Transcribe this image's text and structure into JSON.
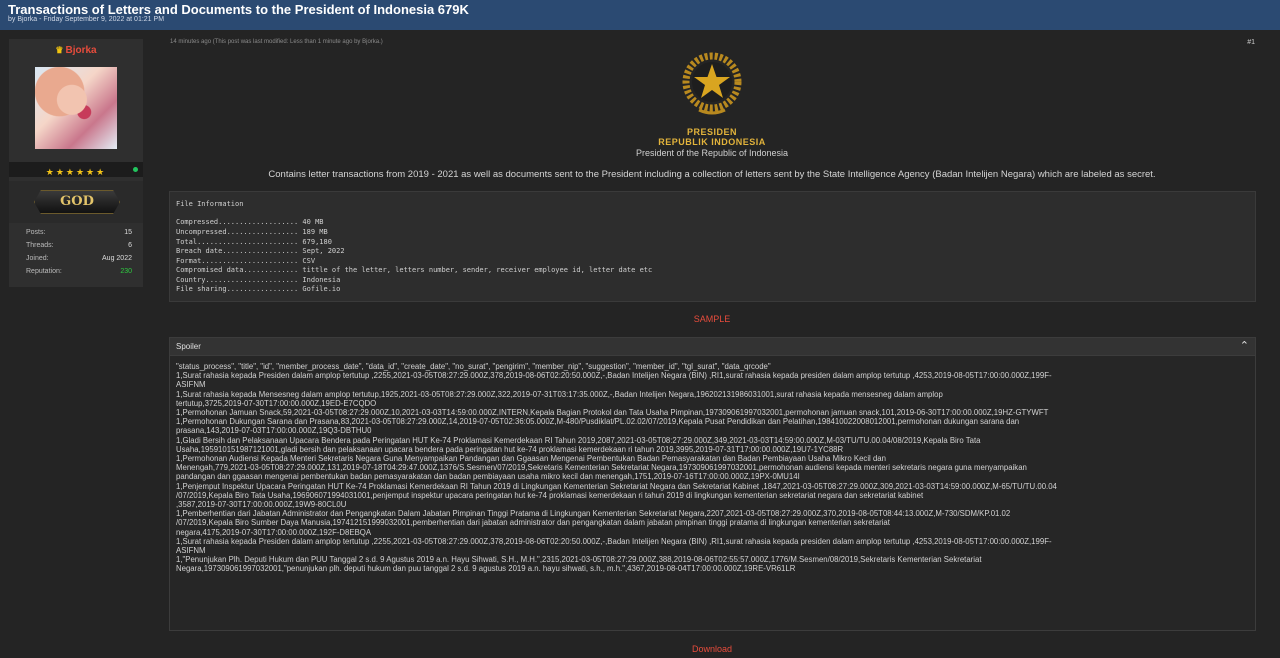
{
  "thread": {
    "title": "Transactions of Letters and Documents to the President of Indonesia 679K",
    "byline": "by Bjorka - Friday September 9, 2022 at 01:21 PM"
  },
  "user": {
    "name": "Bjorka",
    "stars": "★★★★★★",
    "rank_badge": "GOD",
    "stats": [
      {
        "label": "Posts:",
        "value": "15"
      },
      {
        "label": "Threads:",
        "value": "6"
      },
      {
        "label": "Joined:",
        "value": "Aug 2022"
      },
      {
        "label": "Reputation:",
        "value": "230"
      }
    ],
    "colors": {
      "name": "#e74c3c",
      "reputation": "#2ecc40",
      "online": "#22c55e"
    }
  },
  "post": {
    "meta": "14 minutes ago  (This post was last modified: Less than 1 minute ago by Bjorka.)",
    "number": "#1",
    "emblem_lines": [
      "PRESIDEN",
      "REPUBLIK INDONESIA"
    ],
    "emblem_subtitle": "President of the Republic of Indonesia",
    "description": "Contains letter transactions from 2019 - 2021 as well as documents sent to the President including a collection of letters sent by the State Intelligence Agency (Badan Intelijen Negara) which are labeled as secret.",
    "file_info": [
      "File Information",
      "",
      "Compressed................... 40 MB",
      "Uncompressed................. 189 MB",
      "Total........................ 679,180",
      "Breach date.................. Sept, 2022",
      "Format....................... CSV",
      "Compromised data............. tittle of the letter, letters number, sender, receiver employee id, letter date etc",
      "Country...................... Indonesia",
      "File sharing................. Gofile.io"
    ],
    "sample_label": "SAMPLE",
    "spoiler_label": "Spoiler",
    "spoiler_lines": [
      "\"status_process\", \"title\", \"id\", \"member_process_date\", \"data_id\", \"create_date\", \"no_surat\", \"pengirim\", \"member_nip\", \"suggestion\", \"member_id\", \"tgl_surat\", \"data_qrcode\"",
      "1,Surat rahasia kepada Presiden dalam amplop tertutup ,2255,2021-03-05T08:27:29.000Z,378,2019-08-06T02:20:50.000Z,-,Badan Intelijen Negara (BIN) ,RI1,surat rahasia kepada presiden dalam amplop tertutup ,4253,2019-08-05T17:00:00.000Z,199F-",
      "ASIFNM",
      "1,Surat rahasia kepada Mensesneg dalam amplop tertutup,1925,2021-03-05T08:27:29.000Z,322,2019-07-31T03:17:35.000Z,-,Badan Intelijen Negara,196202131986031001,surat rahasia kepada mensesneg dalam amplop",
      "tertutup,3725,2019-07-30T17:00:00.000Z,19ED-E7CQDO",
      "1,Permohonan Jamuan Snack,59,2021-03-05T08:27:29.000Z,10,2021-03-03T14:59:00.000Z,INTERN,Kepala Bagian Protokol dan Tata Usaha Pimpinan,197309061997032001,permohonan jamuan snack,101,2019-06-30T17:00:00.000Z,19HZ-GTYWFT",
      "1,Permohonan Dukungan Sarana dan Prasana,83,2021-03-05T08:27:29.000Z,14,2019-07-05T02:36:05.000Z,M-480/Pusdiklat/PL.02.02/07/2019,Kepala Pusat Pendidikan dan Pelatihan,198410022008012001,permohonan dukungan sarana dan",
      "prasana,143,2019-07-03T17:00:00.000Z,19Q3-DBTHU0",
      "1,Gladi Bersih dan Pelaksanaan Upacara Bendera pada Peringatan HUT Ke-74 Proklamasi Kemerdekaan RI Tahun 2019,2087,2021-03-05T08:27:29.000Z,349,2021-03-03T14:59:00.000Z,M-03/TU/TU.00.04/08/2019,Kepala Biro Tata",
      "Usaha,195910151987121001,gladi bersih dan pelaksanaan upacara bendera pada peringatan hut ke-74 proklamasi kemerdekaan ri tahun 2019,3995,2019-07-31T17:00:00.000Z,19U7-1YC88R",
      "1,Permohonan Audiensi Kepada Menteri Sekretaris Negara Guna Menyampaikan Pandangan dan Ggaasan Mengenai Pembentukan Badan Pemasyarakatan dan Badan Pembiayaan Usaha Mikro Kecil dan",
      "Menengah,779,2021-03-05T08:27:29.000Z,131,2019-07-18T04:29:47.000Z,1376/S.Sesmen/07/2019,Sekretaris Kementerian Sekretariat Negara,197309061997032001,permohonan audiensi kepada menteri sekretaris negara guna menyampaikan",
      "pandangan dan ggaasan mengenai pembentukan badan pemasyarakatan dan badan pembiayaan usaha mikro kecil dan menengah,1751,2019-07-16T17:00:00.000Z,19PX-0MU14I",
      "1,Penjemput Inspektur Upacara Peringatan HUT Ke-74 Proklamasi Kemerdekaan RI Tahun 2019 di Lingkungan Kementerian Sekretariat Negara dan Sekretariat Kabinet ,1847,2021-03-05T08:27:29.000Z,309,2021-03-03T14:59:00.000Z,M-65/TU/TU.00.04",
      "/07/2019,Kepala Biro Tata Usaha,196906071994031001,penjemput inspektur upacara peringatan hut ke-74 proklamasi kemerdekaan ri tahun 2019 di lingkungan kementerian sekretariat negara dan sekretariat kabinet",
      ",3587,2019-07-30T17:00:00.000Z,19W9-80CL0U",
      "1,Pemberhentian dari Jabatan Administrator dan Pengangkatan Dalam Jabatan Pimpinan Tinggi Pratama di Lingkungan Kementerian Sekretariat Negara,2207,2021-03-05T08:27:29.000Z,370,2019-08-05T08:44:13.000Z,M-730/SDM/KP.01.02",
      "/07/2019,Kepala Biro Sumber Daya Manusia,197412151999032001,pemberhentian dari jabatan administrator dan pengangkatan dalam jabatan pimpinan tinggi pratama di lingkungan kementerian sekretariat",
      "negara,4175,2019-07-30T17:00:00.000Z,192F-D8EBQA",
      "1,Surat rahasia kepada Presiden dalam amplop tertutup  ,2255,2021-03-05T08:27:29.000Z,378,2019-08-06T02:20:50.000Z,-,Badan Intelijen Negara (BIN) ,RI1,surat rahasia kepada presiden dalam amplop tertutup  ,4253,2019-08-05T17:00:00.000Z,199F-",
      "ASIFNM",
      "1,\"Penunjukan Plh. Deputi Hukum dan PUU Tanggal 2 s.d. 9 Agustus 2019 a.n. Hayu Sihwati, S.H., M.H.\",2315,2021-03-05T08:27:29.000Z,388,2019-08-06T02:55:57.000Z,1776/M.Sesmen/08/2019,Sekretaris Kementerian Sekretariat",
      "Negara,197309061997032001,\"penunjukan plh. deputi hukum dan puu tanggal 2 s.d. 9 agustus 2019 a.n. hayu sihwati, s.h., m.h.\",4367,2019-08-04T17:00:00.000Z,19RE-VR61LR"
    ],
    "download_label": "Download"
  },
  "theme": {
    "topbar": "#2b4a72",
    "background": "#242424",
    "accent_red": "#e74c3c",
    "emblem_gold": "#e2b33b"
  }
}
